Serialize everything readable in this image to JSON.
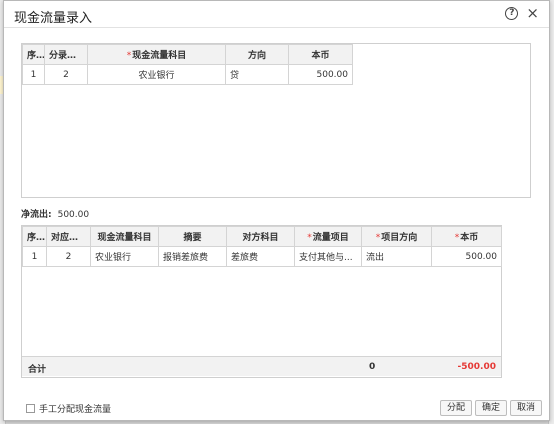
{
  "dialog": {
    "title": "现金流量录入",
    "help_icon": "?",
    "close_icon": "×"
  },
  "upper_table": {
    "columns": [
      "序号",
      "分录序号",
      "现金流量科目",
      "方向",
      "本币"
    ],
    "required_marker": "*",
    "rows": [
      {
        "seq": "1",
        "entry_no": "2",
        "subject": "农业银行",
        "direction": "贷",
        "amount": "500.00"
      }
    ]
  },
  "net_flow": {
    "label": "净流出:",
    "value": "500.00"
  },
  "lower_table": {
    "columns": [
      "序号",
      "对应序号",
      "现金流量科目",
      "摘要",
      "对方科目",
      "流量项目",
      "项目方向",
      "本币"
    ],
    "required_marker": "*",
    "rows": [
      {
        "seq": "1",
        "ref_no": "2",
        "subject": "农业银行",
        "summary": "报销差旅费",
        "counter_subject": "差旅费",
        "flow_item": "支付其他与...",
        "item_direction": "流出",
        "amount": "500.00"
      }
    ],
    "total_label": "合计",
    "total_count": "0",
    "total_amount": "-500.00"
  },
  "colors": {
    "required": "#e53935",
    "negative_total": "#e53935"
  },
  "manual": {
    "label": "手工分配现金流量",
    "checked": false
  },
  "buttons": {
    "assign": "分配",
    "confirm": "确定",
    "cancel": "取消"
  }
}
